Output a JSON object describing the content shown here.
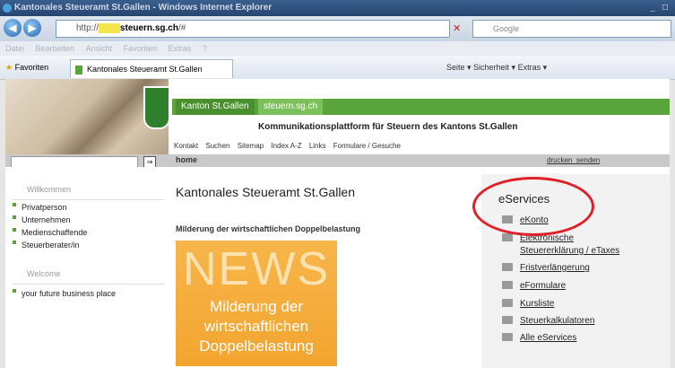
{
  "browser": {
    "title": "Kantonales Steueramt St.Gallen - Windows Internet Explorer",
    "url_prefix": "http://",
    "url_www": "www.",
    "url_domain": "steuern.sg.ch",
    "url_suffix": "/#",
    "search_placeholder": "Google",
    "menu": [
      "Datei",
      "Bearbeiten",
      "Ansicht",
      "Favoriten",
      "Extras",
      "?"
    ],
    "favorites_label": "Favoriten",
    "tab_label": "Kantonales Steueramt St.Gallen",
    "commands": "Seite ▾   Sicherheit ▾   Extras ▾"
  },
  "site": {
    "tab_kanton": "Kanton St.Gallen",
    "tab_steuern": "steuern.sg.ch",
    "headline": "Kommunikationsplattform für Steuern des Kantons St.Gallen",
    "topnav": [
      "Kontakt",
      "Suchen",
      "Sitemap",
      "Index A-Z",
      "Links",
      "Formulare / Gesuche"
    ],
    "breadcrumb": "home",
    "print": "drucken",
    "send": "senden",
    "go": "⇒"
  },
  "left": {
    "welcome_de": "Willkommen",
    "items": [
      "Privatperson",
      "Unternehmen",
      "Medienschaffende",
      "Steuerberater/in"
    ],
    "welcome_en": "Welcome",
    "items_en": [
      "your future business place"
    ]
  },
  "main": {
    "title": "Kantonales Steueramt St.Gallen",
    "teaser": "Milderung der wirtschaftlichen Doppelbelastung",
    "news_word": "NEWS",
    "news_lines": [
      "Milderung der",
      "wirtschaftlichen",
      "Doppelbelastung"
    ]
  },
  "eservices": {
    "heading": "eServices",
    "items": [
      "eKonto",
      "Elektronische",
      "Steuererklärung / eTaxes",
      "Fristverlängerung",
      "eFormulare",
      "Kursliste",
      "Steuerkalkulatoren",
      "Alle eServices"
    ]
  },
  "colors": {
    "green": "#5aa53b",
    "orange": "#f3a42f",
    "highlight_ring": "#e0202a"
  }
}
